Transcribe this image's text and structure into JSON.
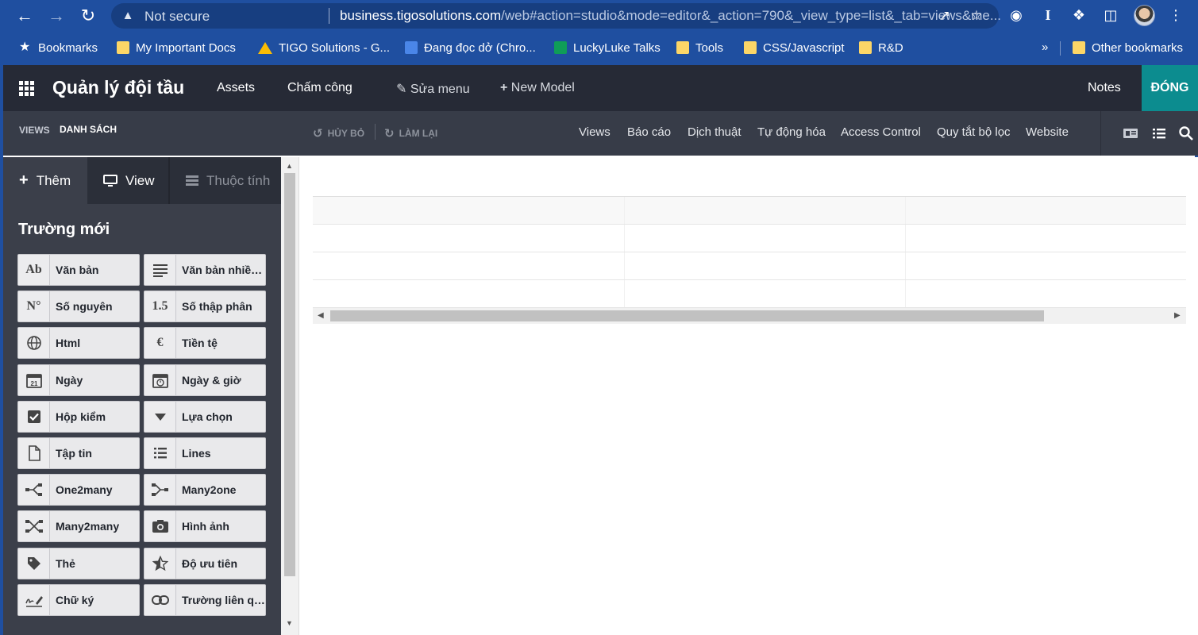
{
  "browser": {
    "security_label": "Not secure",
    "url_host": "business.tigosolutions.com",
    "url_path": "/web#action=studio&mode=editor&_action=790&_view_type=list&_tab=views&me...",
    "bookmarks": [
      {
        "label": "Bookmarks",
        "icon": "star-icon"
      },
      {
        "label": "My Important Docs",
        "icon": "folder-icon"
      },
      {
        "label": "TIGO Solutions - G...",
        "icon": "google-drive-icon"
      },
      {
        "label": "Đang đọc dở (Chro...",
        "icon": "google-docs-icon"
      },
      {
        "label": "LuckyLuke Talks",
        "icon": "google-sheets-icon"
      },
      {
        "label": "Tools",
        "icon": "folder-icon"
      },
      {
        "label": "CSS/Javascript",
        "icon": "folder-icon"
      },
      {
        "label": "R&D",
        "icon": "folder-icon"
      }
    ],
    "more_bookmarks": "»",
    "other_bookmarks": "Other bookmarks"
  },
  "topbar": {
    "app_title": "Quản lý đội tầu",
    "menus": [
      "Assets",
      "Chấm công"
    ],
    "edit_menu": "Sửa menu",
    "new_model": "New Model",
    "notes": "Notes",
    "close": "ĐÓNG"
  },
  "studio": {
    "breadcrumb_views": "VIEWS",
    "breadcrumb_current": "DANH SÁCH",
    "undo": "HỦY BỎ",
    "redo": "LÀM LẠI",
    "tabs": [
      "Views",
      "Báo cáo",
      "Dịch thuật",
      "Tự động hóa",
      "Access Control",
      "Quy tắt bộ lọc",
      "Website"
    ]
  },
  "sidebar": {
    "tabs": {
      "add": "Thêm",
      "view": "View",
      "properties": "Thuộc tính"
    },
    "section_title": "Trường mới",
    "fields": [
      {
        "label": "Văn bản",
        "icon": "Ab"
      },
      {
        "label": "Văn bản nhiều dòng",
        "icon": "≡"
      },
      {
        "label": "Số nguyên",
        "icon": "N°"
      },
      {
        "label": "Số thập phân",
        "icon": "1.5"
      },
      {
        "label": "Html",
        "icon": "globe-icon"
      },
      {
        "label": "Tiền tệ",
        "icon": "€"
      },
      {
        "label": "Ngày",
        "icon": "calendar-icon"
      },
      {
        "label": "Ngày & giờ",
        "icon": "calendar-clock-icon"
      },
      {
        "label": "Hộp kiểm",
        "icon": "checkbox-icon"
      },
      {
        "label": "Lựa chọn",
        "icon": "caret-down-icon"
      },
      {
        "label": "Tập tin",
        "icon": "file-icon"
      },
      {
        "label": "Lines",
        "icon": "list-icon"
      },
      {
        "label": "One2many",
        "icon": "one2many-icon"
      },
      {
        "label": "Many2one",
        "icon": "many2one-icon"
      },
      {
        "label": "Many2many",
        "icon": "many2many-icon"
      },
      {
        "label": "Hình ảnh",
        "icon": "camera-icon"
      },
      {
        "label": "Thẻ",
        "icon": "tag-icon"
      },
      {
        "label": "Độ ưu tiên",
        "icon": "star-half-icon"
      },
      {
        "label": "Chữ ký",
        "icon": "signature-icon"
      },
      {
        "label": "Trường liên quan",
        "icon": "link-icon"
      }
    ]
  },
  "colors": {
    "browser_blue": "#1f4fa0",
    "odoo_dark": "#262a36",
    "studio_bar": "#373c48",
    "sidebar_bg": "#3b3f4a",
    "close_teal": "#0c8c8f"
  }
}
